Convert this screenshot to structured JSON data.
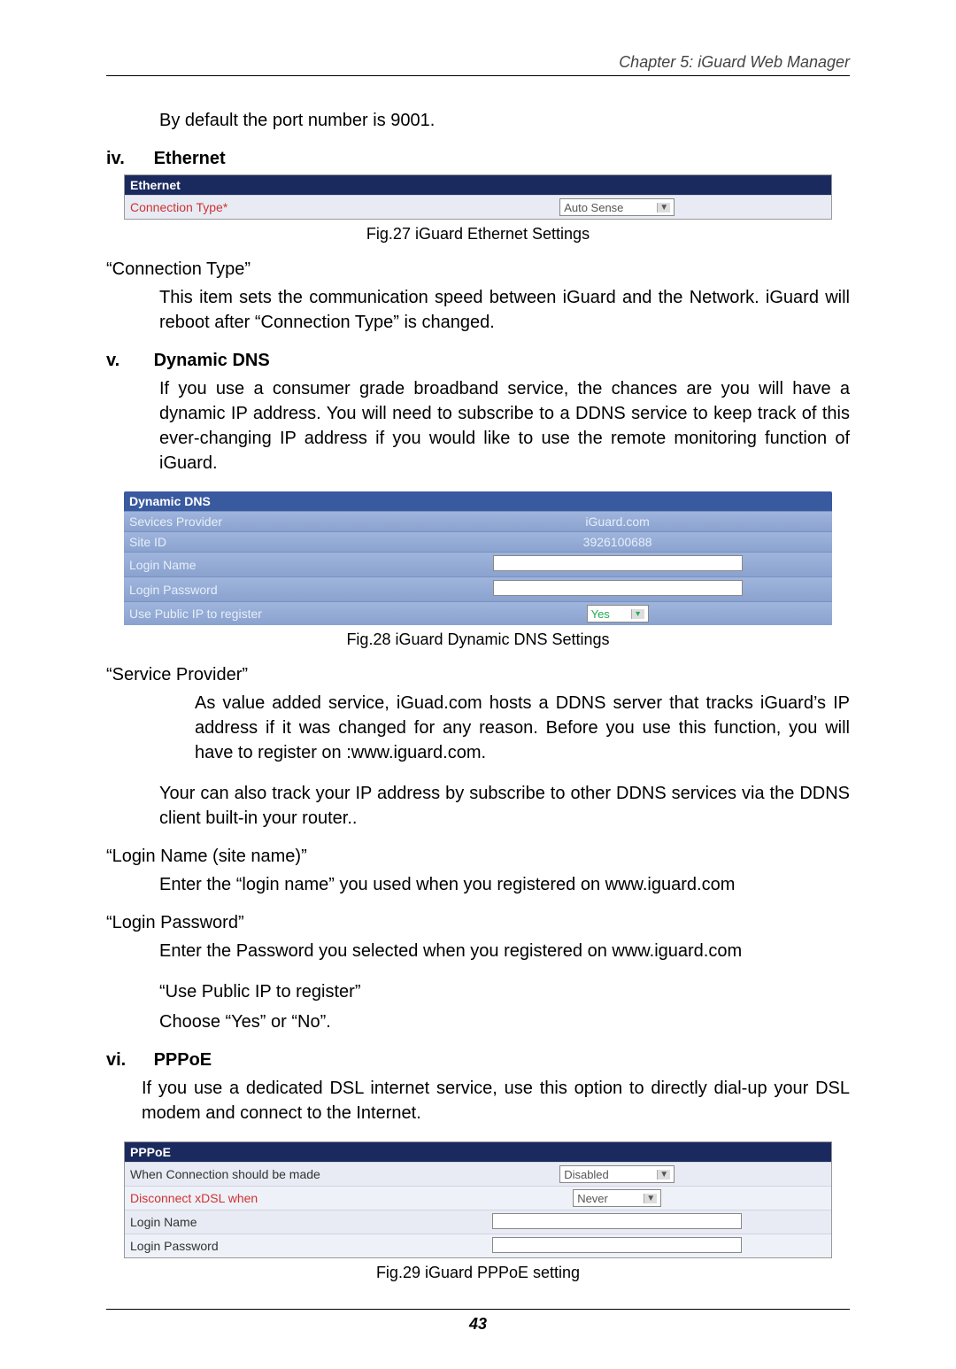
{
  "chapter_header": "Chapter 5: iGuard Web Manager",
  "intro_default_port": "By default the port number is 9001.",
  "sec_iv": {
    "num": "iv.",
    "title": "Ethernet"
  },
  "fig27": {
    "header": "Ethernet",
    "row1_label": "Connection Type*",
    "row1_value": "Auto Sense",
    "caption": "Fig.27  iGuard Ethernet Settings"
  },
  "conn_type_h": "“Connection Type”",
  "conn_type_body": "This item sets the communication speed between iGuard and the Network. iGuard will reboot after “Connection Type” is changed.",
  "sec_v": {
    "num": "v.",
    "title": "Dynamic DNS"
  },
  "ddns_intro": "If you use a consumer grade broadband service, the chances are you will have a dynamic IP address.  You will need to subscribe to a DDNS service to keep track of this ever-changing IP address if you would like to use the remote monitoring function of iGuard.",
  "fig28": {
    "header": "Dynamic DNS",
    "r1l": "Sevices Provider",
    "r1v": "iGuard.com",
    "r2l": "Site ID",
    "r2v": "3926100688",
    "r3l": "Login Name",
    "r4l": "Login Password",
    "r5l": "Use Public IP to register",
    "r5v": "Yes",
    "caption": "Fig.28  iGuard Dynamic DNS Settings"
  },
  "sp_h": "“Service Provider”",
  "sp_body": "As value added service, iGuad.com hosts a DDNS server that tracks iGuard’s IP address if it was changed for any reason.   Before you use this function, you will have to register on :www.iguard.com.",
  "sp_body2": "Your can also track your IP address by subscribe to other DDNS services via the DDNS client built-in your router..",
  "ln_h": "“Login Name (site name)”",
  "ln_body": "Enter the “login name” you used when you registered on www.iguard.com",
  "lp_h": "“Login Password”",
  "lp_body": "Enter the Password you selected when you registered on www.iguard.com",
  "upi_h": "“Use Public IP to register”",
  "upi_body": "Choose “Yes” or “No”.",
  "sec_vi": {
    "num": "vi.",
    "title": "PPPoE"
  },
  "pppoe_intro": "If you use a dedicated DSL internet service, use this option to directly dial-up your DSL modem and connect to the Internet.",
  "fig29": {
    "header": "PPPoE",
    "r1l": "When Connection should be made",
    "r1v": "Disabled",
    "r2l": "Disconnect xDSL when",
    "r2v": "Never",
    "r3l": "Login Name",
    "r4l": "Login Password",
    "caption": "Fig.29  iGuard PPPoE setting"
  },
  "page_number": "43"
}
